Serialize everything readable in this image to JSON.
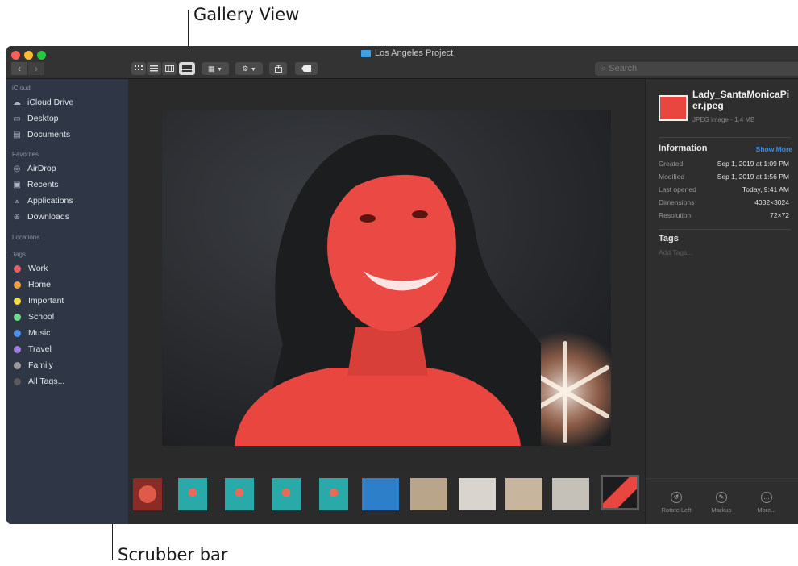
{
  "callouts": {
    "gallery_view": "Gallery View",
    "scrubber_bar": "Scrubber bar"
  },
  "window": {
    "title": "Los Angeles Project"
  },
  "toolbar": {
    "search_placeholder": "Search"
  },
  "sidebar": {
    "sections": {
      "icloud": "iCloud",
      "favorites": "Favorites",
      "locations": "Locations",
      "tags": "Tags"
    },
    "icloud_items": [
      {
        "label": "iCloud Drive",
        "icon": "cloud-icon"
      },
      {
        "label": "Desktop",
        "icon": "desktop-icon"
      },
      {
        "label": "Documents",
        "icon": "document-icon"
      }
    ],
    "favorites_items": [
      {
        "label": "AirDrop",
        "icon": "airdrop-icon"
      },
      {
        "label": "Recents",
        "icon": "recents-icon"
      },
      {
        "label": "Applications",
        "icon": "applications-icon"
      },
      {
        "label": "Downloads",
        "icon": "downloads-icon"
      }
    ],
    "tags": [
      {
        "label": "Work",
        "color": "#e8616a"
      },
      {
        "label": "Home",
        "color": "#f0a040"
      },
      {
        "label": "Important",
        "color": "#f3dd3f"
      },
      {
        "label": "School",
        "color": "#6fdc8c"
      },
      {
        "label": "Music",
        "color": "#4e8ff0"
      },
      {
        "label": "Travel",
        "color": "#a07de0"
      },
      {
        "label": "Family",
        "color": "#9a9a9a"
      },
      {
        "label": "All Tags...",
        "color": "#5a5a5a"
      }
    ]
  },
  "inspector": {
    "file_name": "Lady_SantaMonicaPier.jpeg",
    "file_kind": "JPEG image - 1.4 MB",
    "information_heading": "Information",
    "show_more": "Show More",
    "rows": [
      {
        "key": "Created",
        "value": "Sep 1, 2019 at 1:09 PM"
      },
      {
        "key": "Modified",
        "value": "Sep 1, 2019 at 1:56 PM"
      },
      {
        "key": "Last opened",
        "value": "Today, 9:41 AM"
      },
      {
        "key": "Dimensions",
        "value": "4032×3024"
      },
      {
        "key": "Resolution",
        "value": "72×72"
      }
    ],
    "tags_heading": "Tags",
    "add_tags_placeholder": "Add Tags...",
    "actions": [
      {
        "label": "Rotate Left",
        "icon": "rotate-left-icon"
      },
      {
        "label": "Markup",
        "icon": "markup-icon"
      },
      {
        "label": "More...",
        "icon": "more-icon"
      }
    ]
  },
  "colors": {
    "accent": "#3b8fe8",
    "sidebar": "#2f3746",
    "photo_red": "#e8463f"
  }
}
